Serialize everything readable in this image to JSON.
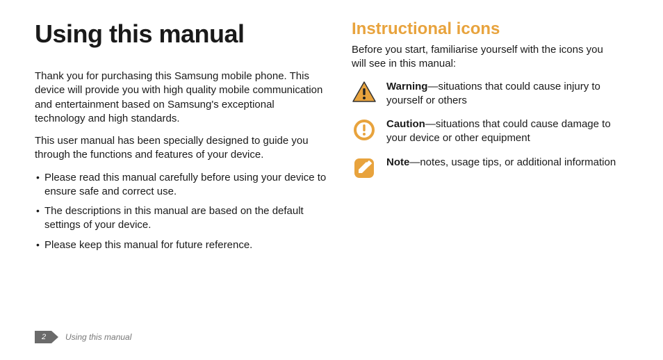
{
  "left": {
    "title": "Using this manual",
    "para1": "Thank you for purchasing this Samsung mobile phone. This device will provide you with high quality mobile communication and entertainment based on Samsung's exceptional technology and high standards.",
    "para2": "This user manual has been specially designed to guide you through the functions and features of your device.",
    "bullets": [
      "Please read this manual carefully before using your device to ensure safe and correct use.",
      "The descriptions in this manual are based on the default settings of your device.",
      "Please keep this manual for future reference."
    ]
  },
  "right": {
    "heading": "Instructional icons",
    "intro": "Before you start, familiarise yourself with the icons you will see in this manual:",
    "items": [
      {
        "label": "Warning",
        "desc": "—situations that could cause injury to yourself or others"
      },
      {
        "label": "Caution",
        "desc": "—situations that could cause damage to your device or other equipment"
      },
      {
        "label": "Note",
        "desc": "—notes, usage tips, or additional information"
      }
    ]
  },
  "footer": {
    "page_number": "2",
    "label": "Using this manual"
  },
  "colors": {
    "accent": "#e8a33d"
  }
}
